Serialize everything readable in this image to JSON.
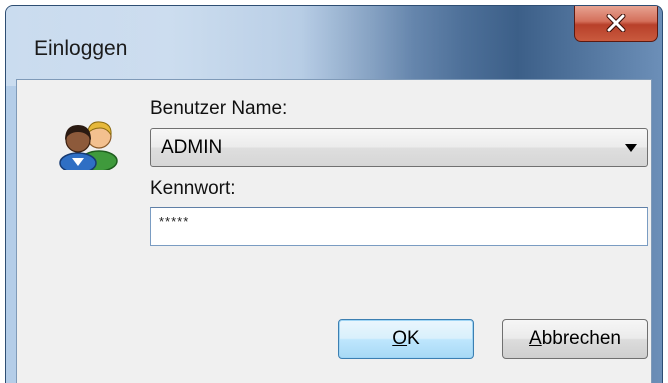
{
  "window": {
    "title": "Einloggen",
    "close_label": "x"
  },
  "form": {
    "username_label": "Benutzer Name:",
    "username_value": "ADMIN",
    "password_label": "Kennwort:",
    "password_value": "*****"
  },
  "buttons": {
    "ok_mnemonic": "O",
    "ok_rest": "K",
    "cancel_mnemonic": "A",
    "cancel_rest": "bbrechen"
  },
  "icons": {
    "users": "users-icon",
    "close": "close-icon",
    "dropdown": "chevron-down-icon"
  },
  "colors": {
    "close_button": "#c95a3e",
    "default_button_border": "#3c7fb1",
    "dialog_background": "#f0f0f0"
  }
}
